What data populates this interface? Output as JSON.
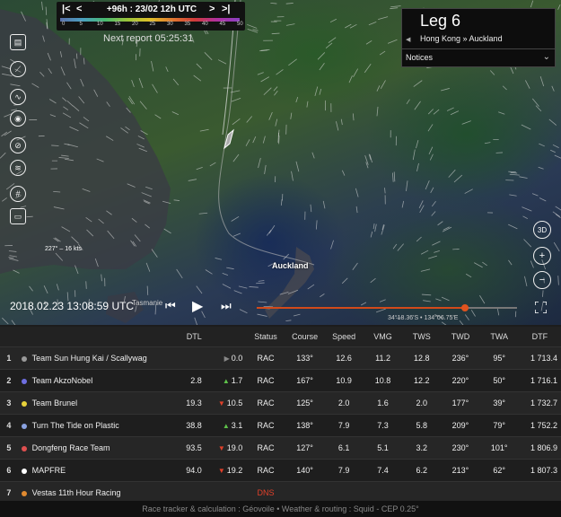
{
  "time_bar": {
    "label": "+96h : 23/02 12h UTC",
    "first_btn": "|<",
    "prev_btn": "<",
    "next_btn": ">",
    "last_btn": ">|",
    "scale_ticks": [
      "0",
      "5",
      "10",
      "15",
      "20",
      "25",
      "30",
      "35",
      "40",
      "45",
      "50"
    ]
  },
  "next_report": "Next report 05:25:31",
  "leg": {
    "title": "Leg 6",
    "route": "Hong Kong » Auckland",
    "prev_arrow": "◀"
  },
  "notices": {
    "label": "Notices",
    "chevron": "⌄"
  },
  "map_labels": {
    "wind": "227° – 16 kts",
    "tasmanie": "Tasmanie",
    "auckland": "Auckland",
    "coordinates": "34°18.36'S • 134°06.75'E"
  },
  "playback": {
    "date": "2018.02.23 13:08:59 UTC",
    "rewind": "⏮",
    "play": "▶",
    "forward": "⏭",
    "progress": 0.8
  },
  "right_tools": {
    "view3d": "3D",
    "zoom_in": "+",
    "zoom_out": "−"
  },
  "table": {
    "headers": [
      "",
      "",
      "DTL",
      "",
      "Status",
      "Course",
      "Speed",
      "VMG",
      "TWS",
      "TWD",
      "TWA",
      "DTF"
    ],
    "rows": [
      {
        "rank": "1",
        "color": "#9a9a9a",
        "team": "Team Sun Hung Kai / Scallywag",
        "dtl": "",
        "delta": "0.0",
        "trend": "flat",
        "status": "RAC",
        "course": "133°",
        "speed": "12.6",
        "vmg": "11.2",
        "tws": "12.8",
        "twd": "236°",
        "twa": "95°",
        "dtf": "1 713.4"
      },
      {
        "rank": "2",
        "color": "#6e6ee0",
        "team": "Team AkzoNobel",
        "dtl": "2.8",
        "delta": "1.7",
        "trend": "up",
        "status": "RAC",
        "course": "167°",
        "speed": "10.9",
        "vmg": "10.8",
        "tws": "12.2",
        "twd": "220°",
        "twa": "50°",
        "dtf": "1 716.1"
      },
      {
        "rank": "3",
        "color": "#e8d23a",
        "team": "Team Brunel",
        "dtl": "19.3",
        "delta": "10.5",
        "trend": "down",
        "status": "RAC",
        "course": "125°",
        "speed": "2.0",
        "vmg": "1.6",
        "tws": "2.0",
        "twd": "177°",
        "twa": "39°",
        "dtf": "1 732.7"
      },
      {
        "rank": "4",
        "color": "#8aa2e0",
        "team": "Turn The Tide on Plastic",
        "dtl": "38.8",
        "delta": "3.1",
        "trend": "up",
        "status": "RAC",
        "course": "138°",
        "speed": "7.9",
        "vmg": "7.3",
        "tws": "5.8",
        "twd": "209°",
        "twa": "79°",
        "dtf": "1 752.2"
      },
      {
        "rank": "5",
        "color": "#e05050",
        "team": "Dongfeng Race Team",
        "dtl": "93.5",
        "delta": "19.0",
        "trend": "down",
        "status": "RAC",
        "course": "127°",
        "speed": "6.1",
        "vmg": "5.1",
        "tws": "3.2",
        "twd": "230°",
        "twa": "101°",
        "dtf": "1 806.9"
      },
      {
        "rank": "6",
        "color": "#ffffff",
        "team": "MAPFRE",
        "dtl": "94.0",
        "delta": "19.2",
        "trend": "down",
        "status": "RAC",
        "course": "140°",
        "speed": "7.9",
        "vmg": "7.4",
        "tws": "6.2",
        "twd": "213°",
        "twa": "62°",
        "dtf": "1 807.3"
      },
      {
        "rank": "7",
        "color": "#e08a30",
        "team": "Vestas 11th Hour Racing",
        "dtl": "",
        "delta": "",
        "trend": "none",
        "status": "DNS",
        "course": "",
        "speed": "",
        "vmg": "",
        "tws": "",
        "twd": "",
        "twa": "",
        "dtf": ""
      }
    ]
  },
  "footer": "Race tracker & calculation : Géovoile • Weather & routing : Squid - CEP 0.25°"
}
